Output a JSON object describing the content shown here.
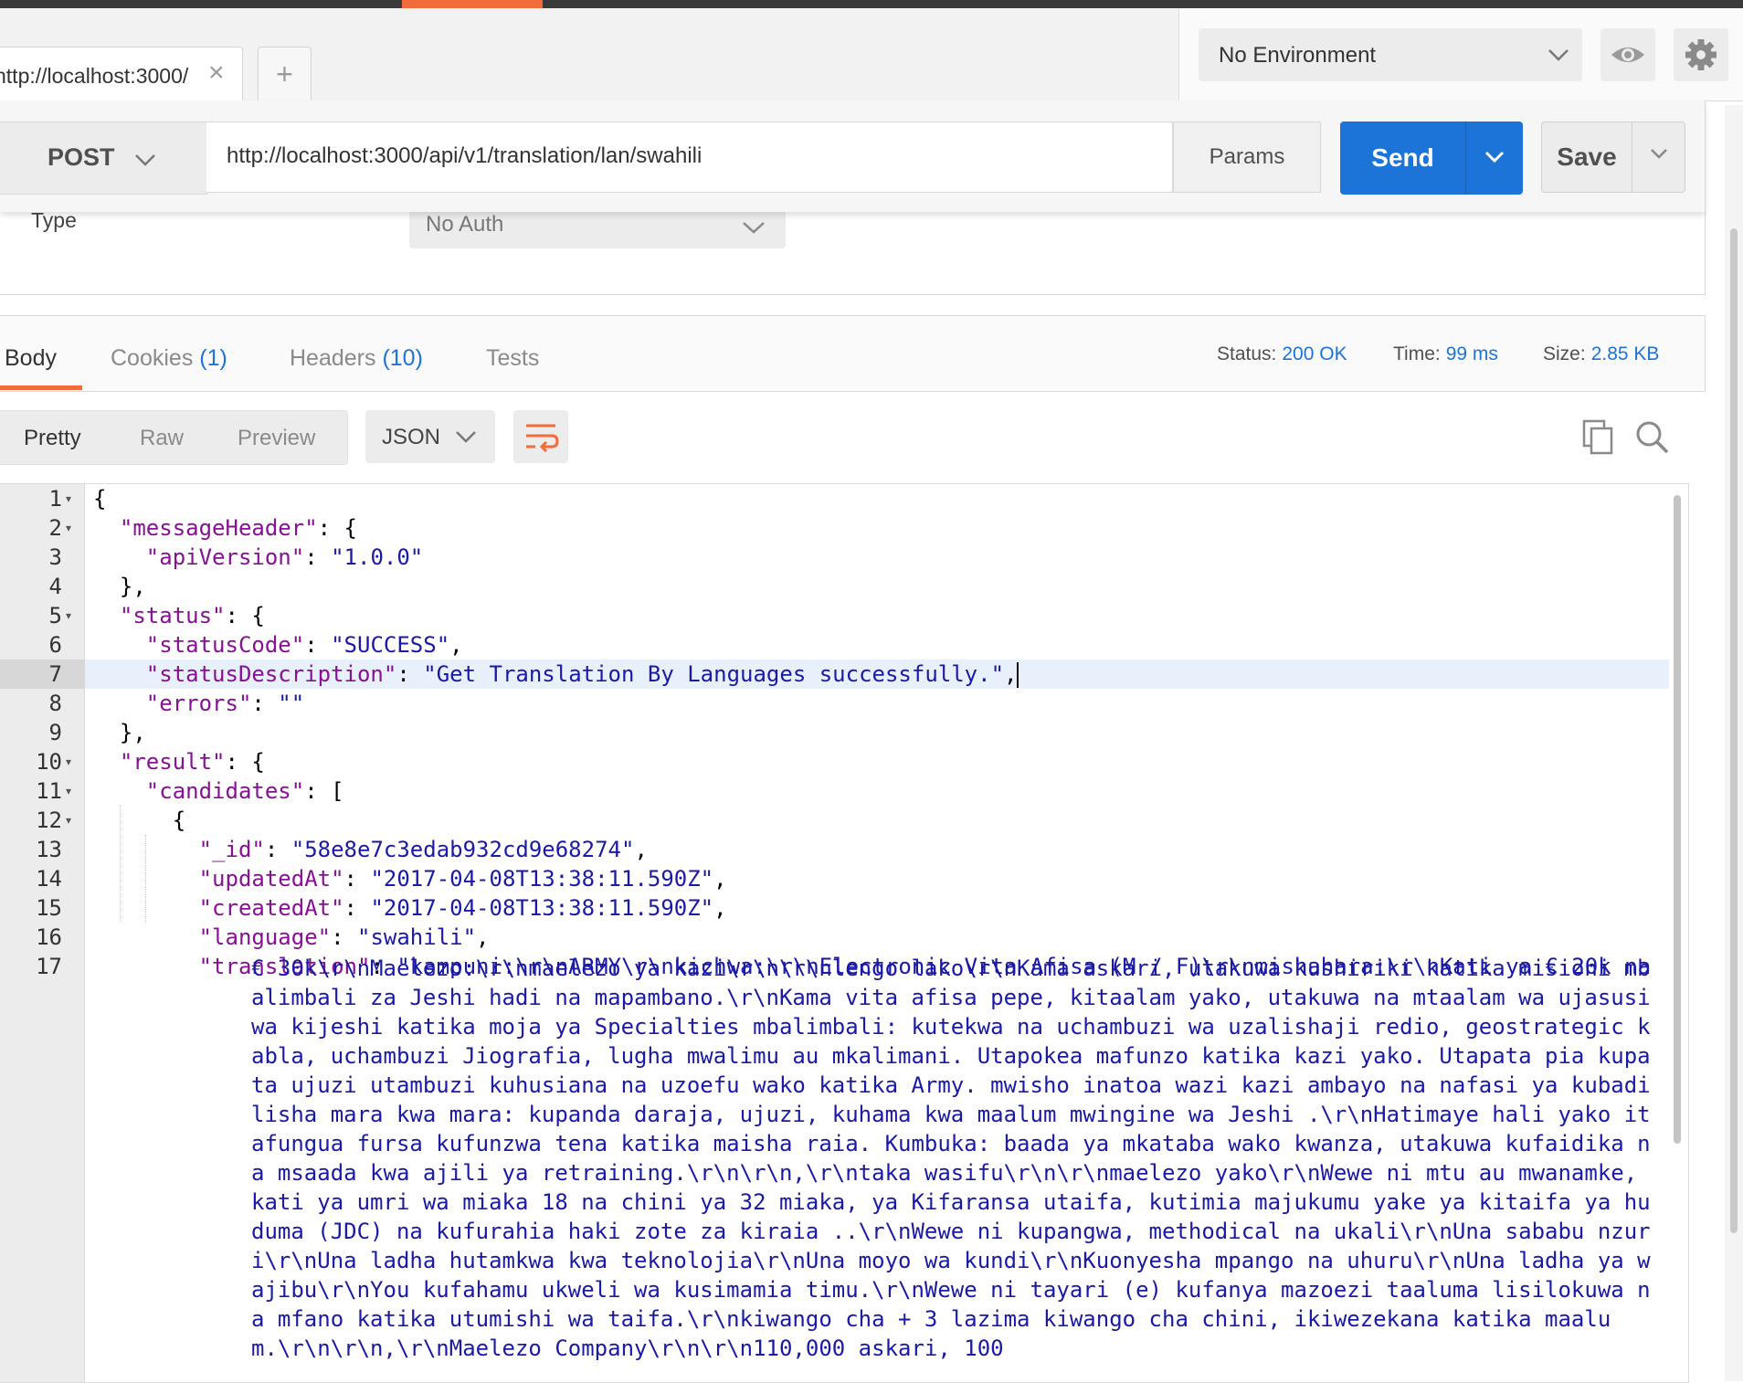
{
  "tabs": {
    "active_label": "http://localhost:3000/",
    "new_tab": "+"
  },
  "environment": {
    "selected": "No Environment"
  },
  "request": {
    "method": "POST",
    "url": "http://localhost:3000/api/v1/translation/lan/swahili",
    "params_label": "Params",
    "send_label": "Send",
    "save_label": "Save"
  },
  "auth": {
    "type_label": "Type",
    "selected": "No Auth"
  },
  "response_tabs": {
    "body": "Body",
    "cookies": "Cookies",
    "cookies_count": "(1)",
    "headers": "Headers",
    "headers_count": "(10)",
    "tests": "Tests"
  },
  "status": {
    "status_label": "Status:",
    "status_value": "200 OK",
    "time_label": "Time:",
    "time_value": "99 ms",
    "size_label": "Size:",
    "size_value": "2.85 KB"
  },
  "format": {
    "pretty": "Pretty",
    "raw": "Raw",
    "preview": "Preview",
    "json": "JSON"
  },
  "editor": {
    "line_numbers": [
      "1",
      "2",
      "3",
      "4",
      "5",
      "6",
      "7",
      "8",
      "9",
      "10",
      "11",
      "12",
      "13",
      "14",
      "15",
      "16",
      "17"
    ],
    "lines": [
      {
        "indent": "",
        "key": "",
        "sep": "{",
        "val": "",
        "tail": ""
      },
      {
        "indent": "  ",
        "key": "\"messageHeader\"",
        "sep": ": {",
        "val": "",
        "tail": ""
      },
      {
        "indent": "    ",
        "key": "\"apiVersion\"",
        "sep": ": ",
        "val": "\"1.0.0\"",
        "tail": ""
      },
      {
        "indent": "  ",
        "key": "",
        "sep": "},",
        "val": "",
        "tail": ""
      },
      {
        "indent": "  ",
        "key": "\"status\"",
        "sep": ": {",
        "val": "",
        "tail": ""
      },
      {
        "indent": "    ",
        "key": "\"statusCode\"",
        "sep": ": ",
        "val": "\"SUCCESS\"",
        "tail": ","
      },
      {
        "indent": "    ",
        "key": "\"statusDescription\"",
        "sep": ": ",
        "val": "\"Get Translation By Languages successfully.\"",
        "tail": ","
      },
      {
        "indent": "    ",
        "key": "\"errors\"",
        "sep": ": ",
        "val": "\"\"",
        "tail": ""
      },
      {
        "indent": "  ",
        "key": "",
        "sep": "},",
        "val": "",
        "tail": ""
      },
      {
        "indent": "  ",
        "key": "\"result\"",
        "sep": ": {",
        "val": "",
        "tail": ""
      },
      {
        "indent": "    ",
        "key": "\"candidates\"",
        "sep": ": [",
        "val": "",
        "tail": ""
      },
      {
        "indent": "      ",
        "key": "",
        "sep": "{",
        "val": "",
        "tail": ""
      },
      {
        "indent": "        ",
        "key": "\"_id\"",
        "sep": ": ",
        "val": "\"58e8e7c3edab932cd9e68274\"",
        "tail": ","
      },
      {
        "indent": "        ",
        "key": "\"updatedAt\"",
        "sep": ": ",
        "val": "\"2017-04-08T13:38:11.590Z\"",
        "tail": ","
      },
      {
        "indent": "        ",
        "key": "\"createdAt\"",
        "sep": ": ",
        "val": "\"2017-04-08T13:38:11.590Z\"",
        "tail": ","
      },
      {
        "indent": "        ",
        "key": "\"language\"",
        "sep": ": ",
        "val": "\"swahili\"",
        "tail": ","
      },
      {
        "indent": "        ",
        "key": "\"translation\"",
        "sep": ": ",
        "val": "\"kampuni:\\r\\nARMY\\r\\nkichwa:\\r\\nElectronic Vita Afisa (M / F)\\r\\nmishahara:\\r\\nKati ya € 20k na",
        "tail": ""
      }
    ],
    "translation_continued": "€ 30k\\r\\nMaelezo:\\r\\nmaelezo ya kazi\\r\\n\\r\\nlengo lako\\r\\nKama askari, utakuwa kushiriki katika misioni mbalimbali za Jeshi hadi na mapambano.\\r\\nKama vita afisa pepe, kitaalam yako, utakuwa na mtaalam wa ujasusi wa kijeshi katika moja ya Specialties mbalimbali: kutekwa na uchambuzi wa uzalishaji redio, geostrategic kabla, uchambuzi Jiografia, lugha mwalimu au mkalimani. Utapokea mafunzo katika kazi yako. Utapata pia kupata ujuzi utambuzi kuhusiana na uzoefu wako katika Army. mwisho inatoa wazi kazi ambayo na nafasi ya kubadilisha mara kwa mara: kupanda daraja, ujuzi, kuhama kwa maalum mwingine wa Jeshi .\\r\\nHatimaye hali yako itafungua fursa kufunzwa tena katika maisha raia. Kumbuka: baada ya mkataba wako kwanza, utakuwa kufaidika na msaada kwa ajili ya retraining.\\r\\n\\r\\n,\\r\\ntaka wasifu\\r\\n\\r\\nmaelezo yako\\r\\nWewe ni mtu au mwanamke, kati ya umri wa miaka 18 na chini ya 32 miaka, ya Kifaransa utaifa, kutimia majukumu yake ya kitaifa ya huduma (JDC) na kufurahia haki zote za kiraia ..\\r\\nWewe ni kupangwa, methodical na ukali\\r\\nUna sababu nzuri\\r\\nUna ladha hutamkwa kwa teknolojia\\r\\nUna moyo wa kundi\\r\\nKuonyesha mpango na uhuru\\r\\nUna ladha ya wajibu\\r\\nYou kufahamu ukweli wa kusimamia timu.\\r\\nWewe ni tayari (e) kufanya mazoezi taaluma lisilokuwa na mfano katika utumishi wa taifa.\\r\\nkiwango cha + 3 lazima kiwango cha chini, ikiwezekana katika maalum.\\r\\n\\r\\n,\\r\\nMaelezo Company\\r\\n\\r\\n110,000 askari, 100"
  }
}
